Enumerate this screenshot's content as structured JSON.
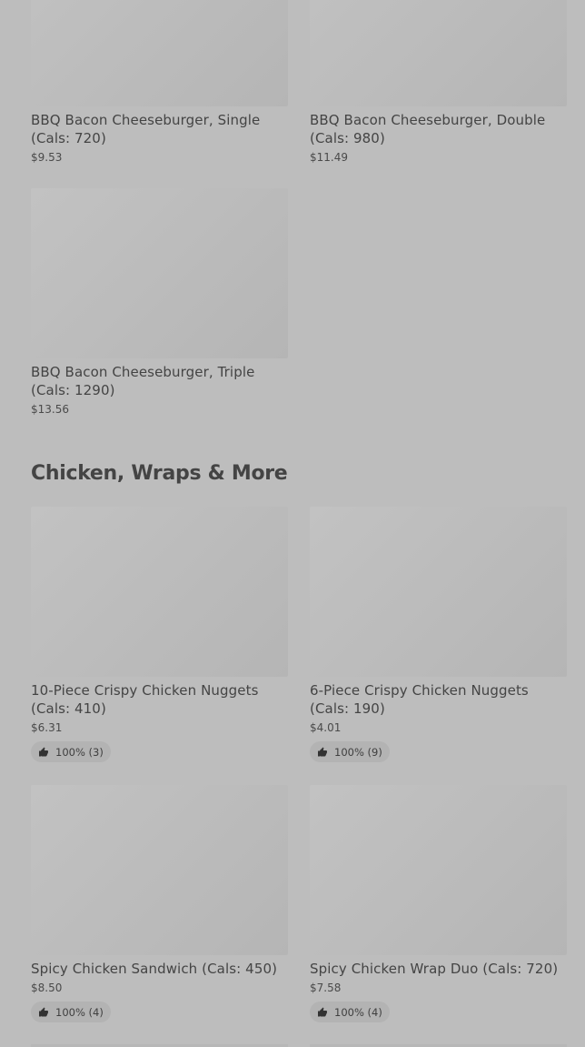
{
  "sections": [
    {
      "title": "",
      "items": [
        {
          "name": "BBQ Bacon Cheeseburger, Single (Cals: 720)",
          "price": "$9.53"
        },
        {
          "name": "BBQ Bacon Cheeseburger, Double (Cals: 980)",
          "price": "$11.49"
        },
        {
          "name": "BBQ Bacon Cheeseburger, Triple (Cals: 1290)",
          "price": "$13.56"
        }
      ]
    },
    {
      "title": "Chicken, Wraps & More",
      "items": [
        {
          "name": "10-Piece Crispy Chicken Nuggets (Cals: 410)",
          "price": "$6.31",
          "rating": "100% (3)"
        },
        {
          "name": "6-Piece Crispy Chicken Nuggets (Cals: 190)",
          "price": "$4.01",
          "rating": "100% (9)"
        },
        {
          "name": "Spicy Chicken Sandwich (Cals: 450)",
          "price": "$8.50",
          "rating": "100% (4)"
        },
        {
          "name": "Spicy Chicken Wrap Duo (Cals: 720)",
          "price": "$7.58",
          "rating": "100% (4)"
        }
      ]
    }
  ],
  "icons": {
    "rating": "thumbs-up-icon"
  },
  "colors": {
    "background": "#bdbdbd",
    "image_placeholder": "#bababa",
    "badge": "#b3b3b3",
    "text": "#444444"
  }
}
